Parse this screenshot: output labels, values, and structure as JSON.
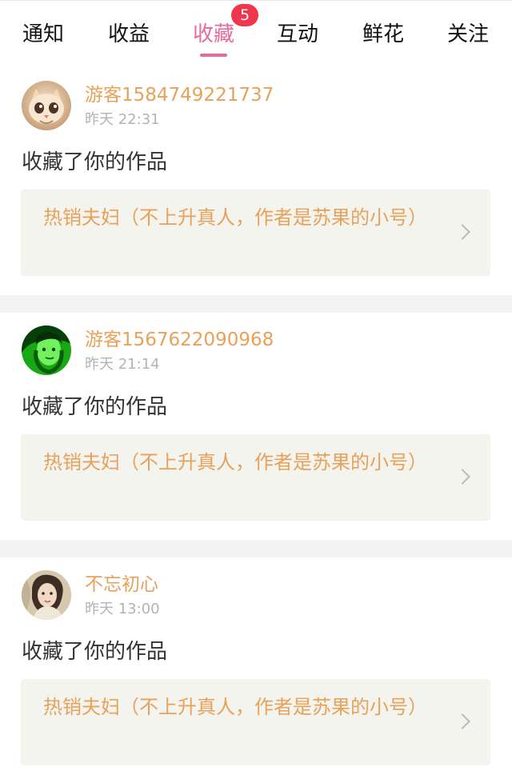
{
  "tabs": [
    {
      "label": "通知",
      "active": false
    },
    {
      "label": "收益",
      "active": false
    },
    {
      "label": "收藏",
      "active": true,
      "badge": "5"
    },
    {
      "label": "互动",
      "active": false
    },
    {
      "label": "鲜花",
      "active": false
    },
    {
      "label": "关注",
      "active": false
    }
  ],
  "colors": {
    "active_tab": "#e56b9d",
    "badge": "#f0364a",
    "username": "#e8a15a",
    "timestamp": "#b3b3b3",
    "work_title": "#e8a15a",
    "work_background": "#f4f4ef",
    "separator": "#f3f3f3"
  },
  "feed": [
    {
      "avatar_icon": "cat-avatar-icon",
      "username": "游客1584749221737",
      "timestamp": "昨天 22:31",
      "action": "收藏了你的作品",
      "work_title": "热销夫妇（不上升真人，作者是苏果的小号）"
    },
    {
      "avatar_icon": "green-portrait-avatar-icon",
      "username": "游客1567622090968",
      "timestamp": "昨天 21:14",
      "action": "收藏了你的作品",
      "work_title": "热销夫妇（不上升真人，作者是苏果的小号）"
    },
    {
      "avatar_icon": "portrait-avatar-icon",
      "username": "不忘初心",
      "timestamp": "昨天 13:00",
      "action": "收藏了你的作品",
      "work_title": "热销夫妇（不上升真人，作者是苏果的小号）"
    }
  ]
}
